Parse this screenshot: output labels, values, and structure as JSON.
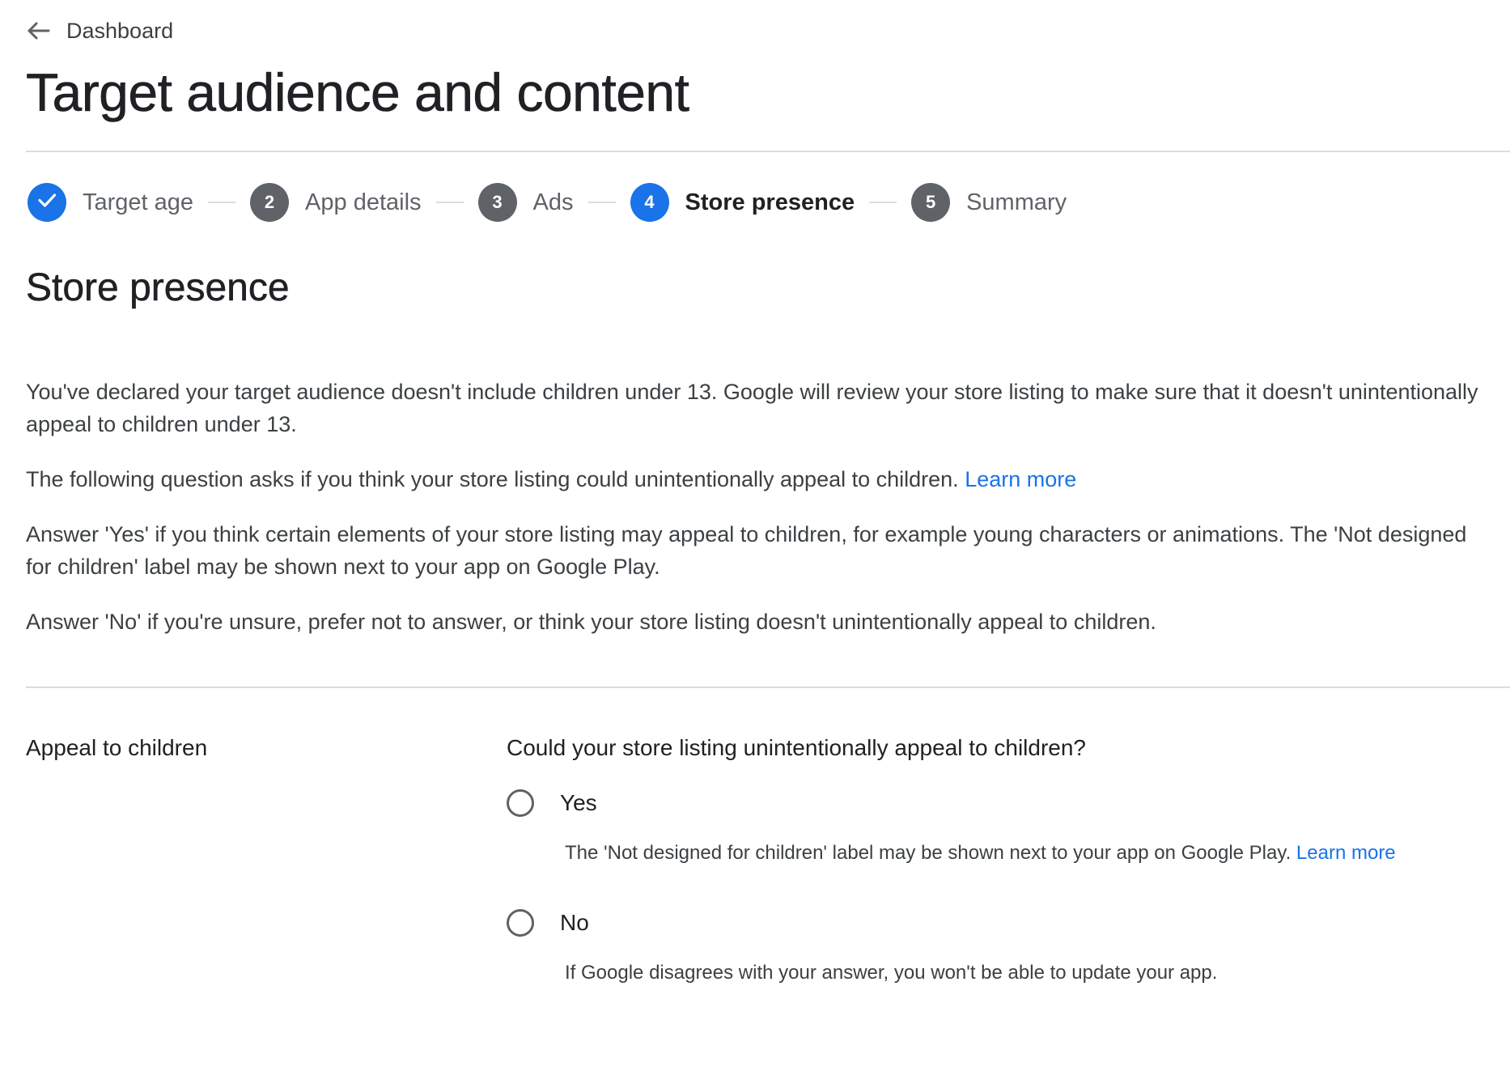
{
  "header": {
    "back_label": "Dashboard",
    "title": "Target audience and content"
  },
  "stepper": {
    "active_color": "#1a73e8",
    "inactive_color": "#5f6368",
    "steps": [
      {
        "number": "",
        "label": "Target age",
        "state": "completed",
        "icon": "checkmark-icon"
      },
      {
        "number": "2",
        "label": "App details",
        "state": "upcoming"
      },
      {
        "number": "3",
        "label": "Ads",
        "state": "upcoming"
      },
      {
        "number": "4",
        "label": "Store presence",
        "state": "active"
      },
      {
        "number": "5",
        "label": "Summary",
        "state": "upcoming"
      }
    ]
  },
  "section": {
    "title": "Store presence",
    "paragraphs": [
      "You've declared your target audience doesn't include children under 13. Google will review your store listing to make sure that it doesn't unintentionally appeal to children under 13.",
      "The following question asks if you think your store listing could unintentionally appeal to children.",
      "Answer 'Yes' if you think certain elements of your store listing may appeal to children, for example young characters or animations. The 'Not designed for children' label may be shown next to your app on Google Play.",
      "Answer 'No' if you're unsure, prefer not to answer, or think your store listing doesn't unintentionally appeal to children."
    ],
    "learn_more": "Learn more"
  },
  "form": {
    "field_label": "Appeal to children",
    "question": "Could your store listing unintentionally appeal to children?",
    "options": [
      {
        "label": "Yes",
        "help": "The 'Not designed for children' label may be shown next to your app on Google Play.",
        "link": "Learn more",
        "selected": false
      },
      {
        "label": "No",
        "help": "If Google disagrees with your answer, you won't be able to update your app.",
        "selected": false
      }
    ]
  }
}
